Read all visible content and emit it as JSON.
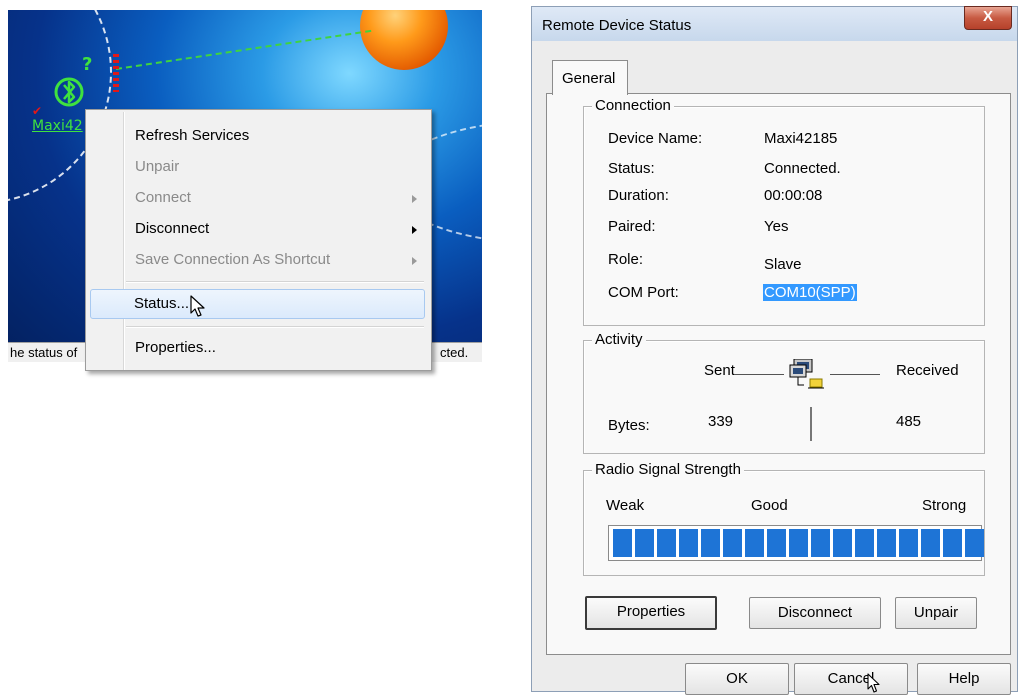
{
  "left_screenshot": {
    "device_label": "Maxi42",
    "status_left": "he status of",
    "status_right": "cted.",
    "context_menu": {
      "items": [
        {
          "label": "Refresh Services",
          "disabled": false,
          "submenu": false
        },
        {
          "label": "Unpair",
          "disabled": true,
          "submenu": false
        },
        {
          "label": "Connect",
          "disabled": true,
          "submenu": true
        },
        {
          "label": "Disconnect",
          "disabled": false,
          "submenu": true
        },
        {
          "label": "Save Connection As Shortcut",
          "disabled": true,
          "submenu": true
        },
        {
          "label": "Status...",
          "disabled": false,
          "submenu": false,
          "highlighted": true
        },
        {
          "label": "Properties...",
          "disabled": false,
          "submenu": false
        }
      ]
    }
  },
  "dialog": {
    "title": "Remote Device Status",
    "close_glyph": "X",
    "tab_general": "General",
    "connection": {
      "group_title": "Connection",
      "device_name_label": "Device Name:",
      "device_name": "Maxi42185",
      "status_label": "Status:",
      "status": "Connected.",
      "duration_label": "Duration:",
      "duration": "00:00:08",
      "paired_label": "Paired:",
      "paired": "Yes",
      "role_label": "Role:",
      "role": "Slave",
      "com_port_label": "COM Port:",
      "com_port": "COM10(SPP)"
    },
    "activity": {
      "group_title": "Activity",
      "sent_label": "Sent",
      "received_label": "Received",
      "bytes_label": "Bytes:",
      "bytes_sent": "339",
      "bytes_received": "485"
    },
    "signal": {
      "group_title": "Radio Signal Strength",
      "weak_label": "Weak",
      "good_label": "Good",
      "strong_label": "Strong",
      "level_fraction": 1.0,
      "bar_color": "#1e74d6"
    },
    "buttons": {
      "properties": "Properties",
      "disconnect": "Disconnect",
      "unpair": "Unpair",
      "ok": "OK",
      "cancel": "Cancel",
      "help": "Help"
    }
  }
}
